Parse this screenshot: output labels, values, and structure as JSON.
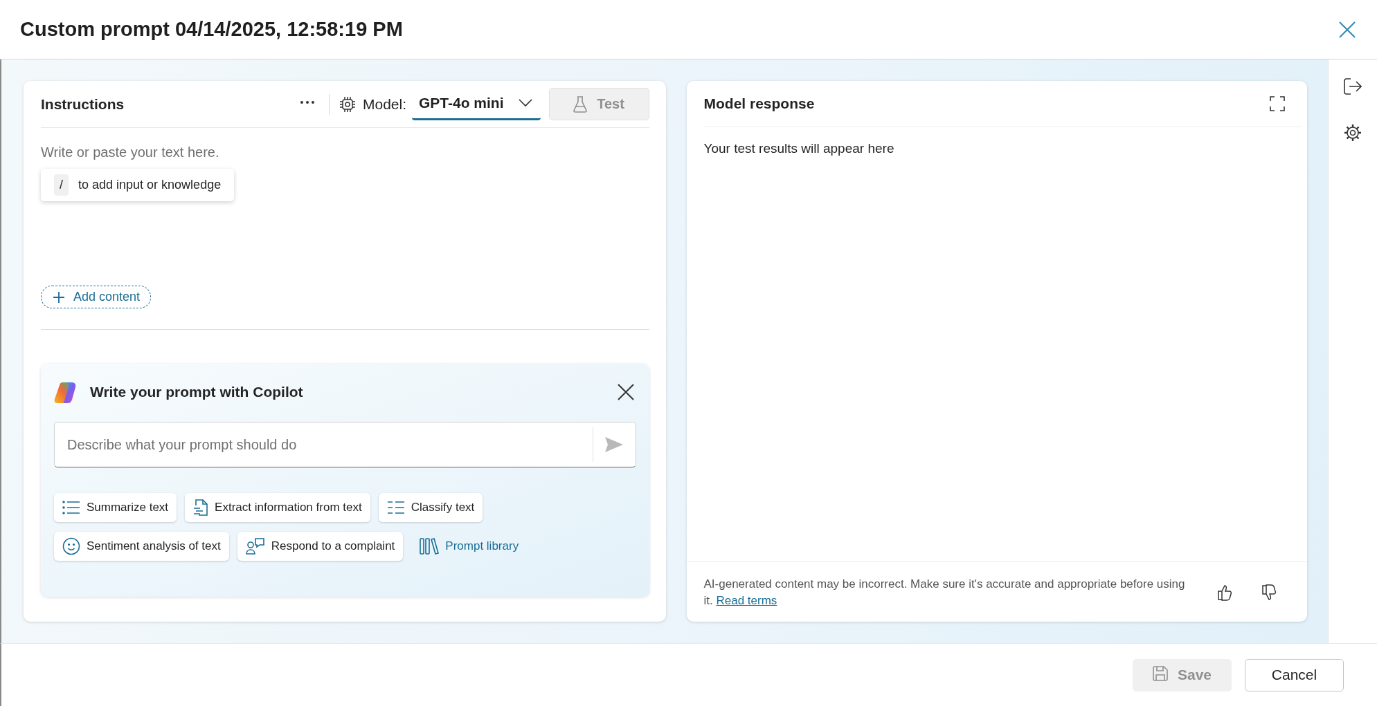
{
  "window": {
    "title": "Custom prompt 04/14/2025, 12:58:19 PM"
  },
  "instructions": {
    "title": "Instructions",
    "model_label": "Model:",
    "model_value": "GPT-4o mini",
    "test_button": {
      "label": "Test",
      "disabled": true
    },
    "editor": {
      "placeholder": "Write or paste your text here."
    },
    "hint": {
      "key": "/",
      "text": "to add input or knowledge"
    },
    "add_content": "Add content"
  },
  "copilot": {
    "title": "Write your prompt with Copilot",
    "input": {
      "placeholder": "Describe what your prompt should do"
    },
    "suggestions": [
      {
        "label": "Summarize text",
        "kind": "chip"
      },
      {
        "label": "Extract information from text",
        "kind": "chip"
      },
      {
        "label": "Classify text",
        "kind": "chip"
      },
      {
        "label": "Sentiment analysis of text",
        "kind": "chip"
      },
      {
        "label": "Respond to a complaint",
        "kind": "chip"
      },
      {
        "label": "Prompt library",
        "kind": "link"
      }
    ]
  },
  "response": {
    "title": "Model response",
    "empty_text": "Your test results will appear here",
    "disclaimer": "AI-generated content may be incorrect. Make sure it's accurate and appropriate before using it.",
    "terms_link": "Read terms"
  },
  "footer": {
    "buttons": [
      {
        "label": "Save",
        "kind": "primary",
        "disabled": true
      },
      {
        "label": "Cancel",
        "kind": "secondary",
        "disabled": false
      }
    ]
  }
}
